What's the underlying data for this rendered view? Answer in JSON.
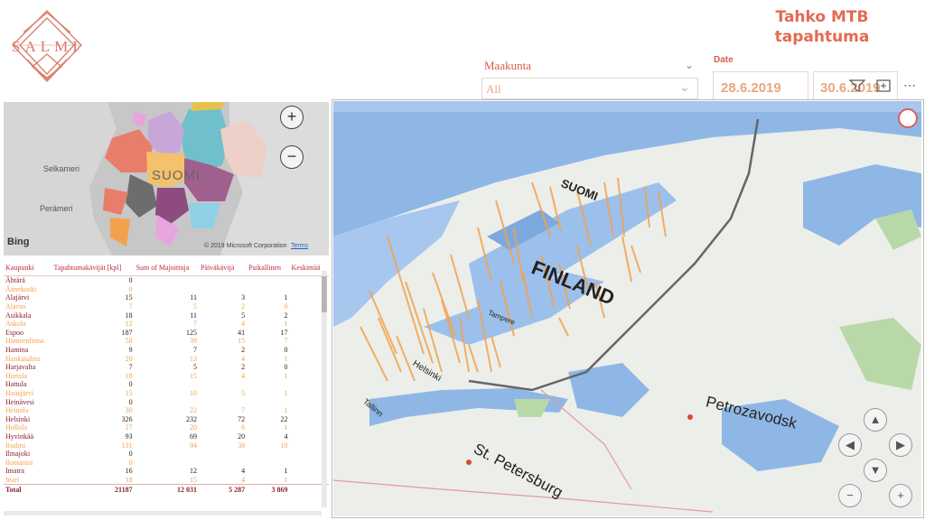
{
  "logo": {
    "text": "SALMI"
  },
  "header": {
    "title_line1": "Tahko MTB",
    "title_line2": "tapahtuma"
  },
  "slicers": {
    "maakunta": {
      "label": "Maakunta",
      "value": "All"
    },
    "date": {
      "label": "Date",
      "start": "28.6.2019",
      "end": "30.6.2019"
    }
  },
  "small_map": {
    "labels": {
      "selkameri": "Selkameri",
      "perameri": "Perämeri",
      "suomi": "SUOMI"
    },
    "bing": "Bing",
    "copyright": "© 2019 Microsoft Corporation",
    "terms": "Terms",
    "zoom_in": "+",
    "zoom_out": "−"
  },
  "table": {
    "columns": [
      "Kaupunki",
      "Tapahtumakävijät [kpl]",
      "Sum of Majoittuja",
      "Päiväkävijä",
      "Paikallinen",
      "Keskimää"
    ],
    "rows": [
      [
        "Ähtärä",
        "0",
        "",
        "",
        "",
        ""
      ],
      [
        "Äänekoski",
        "0",
        "",
        "",
        "",
        ""
      ],
      [
        "Alajärvi",
        "15",
        "11",
        "3",
        "1",
        ""
      ],
      [
        "Alavus",
        "7",
        "5",
        "2",
        "0",
        ""
      ],
      [
        "Asikkala",
        "18",
        "11",
        "5",
        "2",
        ""
      ],
      [
        "Askola",
        "12",
        "7",
        "4",
        "1",
        ""
      ],
      [
        "Espoo",
        "187",
        "125",
        "41",
        "17",
        ""
      ],
      [
        "Hämeenlinna",
        "58",
        "39",
        "15",
        "7",
        ""
      ],
      [
        "Hamina",
        "9",
        "7",
        "2",
        "0",
        ""
      ],
      [
        "Hankasalmi",
        "20",
        "13",
        "4",
        "1",
        ""
      ],
      [
        "Harjavalta",
        "7",
        "5",
        "2",
        "0",
        ""
      ],
      [
        "Hartola",
        "18",
        "15",
        "4",
        "1",
        ""
      ],
      [
        "Hattula",
        "0",
        "",
        "",
        "",
        ""
      ],
      [
        "Hausjärvi",
        "15",
        "10",
        "5",
        "1",
        ""
      ],
      [
        "Heinävesi",
        "0",
        "",
        "",
        "",
        ""
      ],
      [
        "Heinola",
        "30",
        "22",
        "7",
        "1",
        ""
      ],
      [
        "Helsinki",
        "326",
        "232",
        "72",
        "22",
        ""
      ],
      [
        "Hollola",
        "27",
        "20",
        "6",
        "1",
        ""
      ],
      [
        "Hyvinkää",
        "93",
        "69",
        "20",
        "4",
        ""
      ],
      [
        "Iisalmi",
        "131",
        "94",
        "38",
        "18",
        ""
      ],
      [
        "Ilmajoki",
        "0",
        "",
        "",
        "",
        ""
      ],
      [
        "Ilomantsi",
        "0",
        "",
        "",
        "",
        ""
      ],
      [
        "Imatra",
        "16",
        "12",
        "4",
        "1",
        ""
      ],
      [
        "Inari",
        "18",
        "15",
        "4",
        "1",
        ""
      ]
    ],
    "total": [
      "Total",
      "21187",
      "12 031",
      "5 287",
      "3 869",
      ""
    ]
  },
  "big_map": {
    "labels": {
      "finland": "FINLAND",
      "suomi": "SUOMI",
      "petrozavodsk": "Petrozavodsk",
      "st_petersburg": "St. Petersburg",
      "helsinki": "Helsinki",
      "tallinn": "Tallinn",
      "tampere": "Tampere"
    }
  },
  "colors": {
    "accent": "#e36a52",
    "date_value": "#e8a77e",
    "bar": "#f2a24d",
    "water": "#8fb8e6",
    "land": "#eceeea"
  }
}
